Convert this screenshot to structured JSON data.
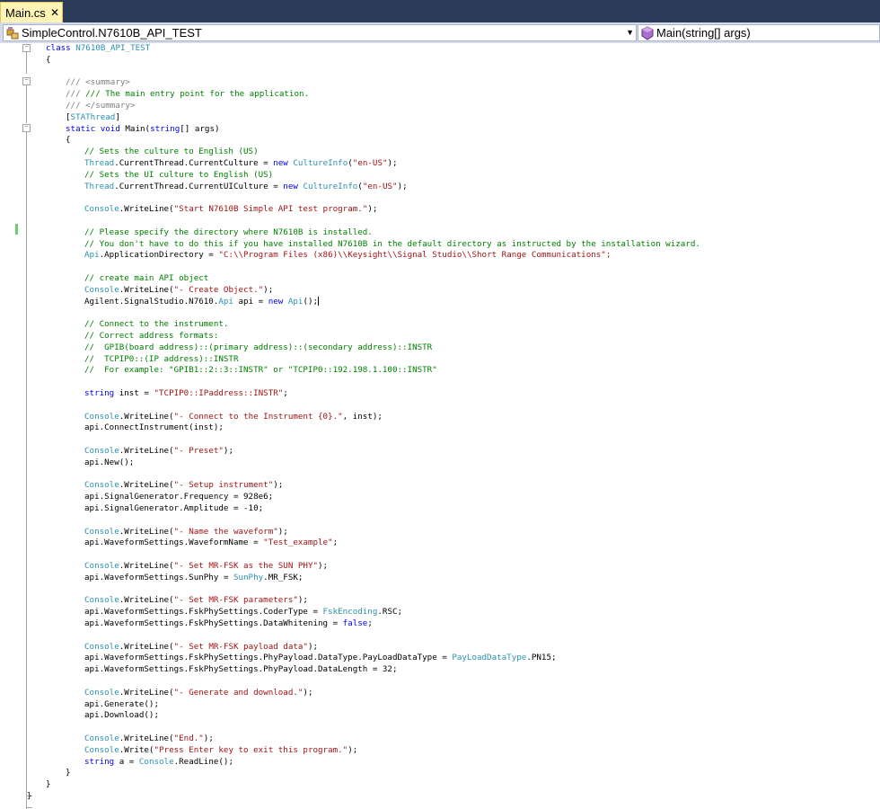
{
  "tab": {
    "title": "Main.cs",
    "close": "✕"
  },
  "navbar": {
    "type_selector": {
      "value": "SimpleControl.N7610B_API_TEST",
      "icon": "class-icon"
    },
    "member_selector": {
      "value": "Main(string[] args)",
      "icon": "method-icon"
    }
  },
  "code": {
    "class_kw": "class",
    "class_name": "N7610B_API_TEST",
    "open_class": "{",
    "doc1": "/// <summary>",
    "doc2": "/// The main entry point for the application.",
    "doc3": "/// </summary>",
    "attr_open": "[",
    "attr_name": "STAThread",
    "attr_close": "]",
    "main_kw": "static void",
    "main_name": " Main(",
    "main_kw2": "string",
    "main_rest": "[] args)",
    "open_method": "{",
    "c_culture": "// Sets the culture to English (US)",
    "thread": "Thread",
    "l_culture": ".CurrentThread.CurrentCulture = ",
    "new": "new",
    "cultureinfo": "CultureInfo",
    "paren_open": "(",
    "en_us": "\"en-US\"",
    "paren_close_semi": ");",
    "c_ui_culture": "// Sets the UI culture to English (US)",
    "l_ui_culture": ".CurrentThread.CurrentUICulture = ",
    "console": "Console",
    "writeline": ".WriteLine(",
    "s_start": "\"Start N7610B Simple API test program.\"",
    "c_dir1": "// Please specify the directory where N7610B is installed.",
    "c_dir2": "// You don't have to do this if you have installed N7610B in the default directory as instructed by the installation wizard.",
    "api": "Api",
    "l_appdir": ".ApplicationDirectory = ",
    "s_appdir": "\"C:\\\\Program Files (x86)\\\\Keysight\\\\Signal Studio\\\\Short Range Communications\";",
    "c_create": "// create main API object",
    "s_create": "\"- Create Object.\"",
    "l_agilent": "Agilent.SignalStudio.N7610.",
    "l_api_eq": " api = ",
    "l_api_end": "();",
    "c_connect1": "// Connect to the instrument.",
    "c_connect2": "// Correct address formats:",
    "c_connect3": "//  GPIB(board address)::(primary address)::(secondary address)::INSTR",
    "c_connect4": "//  TCPIP0::(IP address)::INSTR",
    "c_connect5": "//  For example: \"GPIB1::2::3::INSTR\" or \"TCPIP0::192.198.1.100::INSTR\"",
    "string_kw": "string",
    "l_inst": " inst = ",
    "s_inst": "\"TCPIP0::IPaddress::INSTR\"",
    "semi": ";",
    "s_connect": "\"- Connect to the Instrument {0}.\"",
    "l_connect_rest": ", inst);",
    "l_connectinstrument": "api.ConnectInstrument(inst);",
    "s_preset": "\"- Preset\"",
    "l_new": "api.New();",
    "s_setup": "\"- Setup instrument\"",
    "l_freq": "api.SignalGenerator.Frequency = 928e6;",
    "l_amp": "api.SignalGenerator.Amplitude = -10;",
    "s_name": "\"- Name the waveform\"",
    "l_wfname": "api.WaveformSettings.WaveformName = ",
    "s_wfname": "\"Test_example\"",
    "s_sunphy": "\"- Set MR-FSK as the SUN PHY\"",
    "l_sunphy": "api.WaveformSettings.SunPhy = ",
    "sunphy_ty": "SunPhy",
    "l_mrfsk": ".MR_FSK;",
    "s_params": "\"- Set MR-FSK parameters\"",
    "l_coder": "api.WaveformSettings.FskPhySettings.CoderType = ",
    "fskenc": "FskEncoding",
    "l_rsc": ".RSC;",
    "l_whiten": "api.WaveformSettings.FskPhySettings.DataWhitening = ",
    "false_kw": "false",
    "s_payload": "\"- Set MR-FSK payload data\"",
    "l_ptype": "api.WaveformSettings.FskPhySettings.PhyPayload.DataType.PayLoadDataType = ",
    "pldt": "PayLoadDataType",
    "l_pn15": ".PN15;",
    "l_plen": "api.WaveformSettings.FskPhySettings.PhyPayload.DataLength = 32;",
    "s_gen": "\"- Generate and download.\"",
    "l_generate": "api.Generate();",
    "l_download": "api.Download();",
    "s_end": "\"End.\"",
    "write": ".Write(",
    "s_press": "\"Press Enter key to exit this program.\"",
    "l_a": " a = ",
    "readline": ".ReadLine();",
    "close_brace": "}"
  }
}
